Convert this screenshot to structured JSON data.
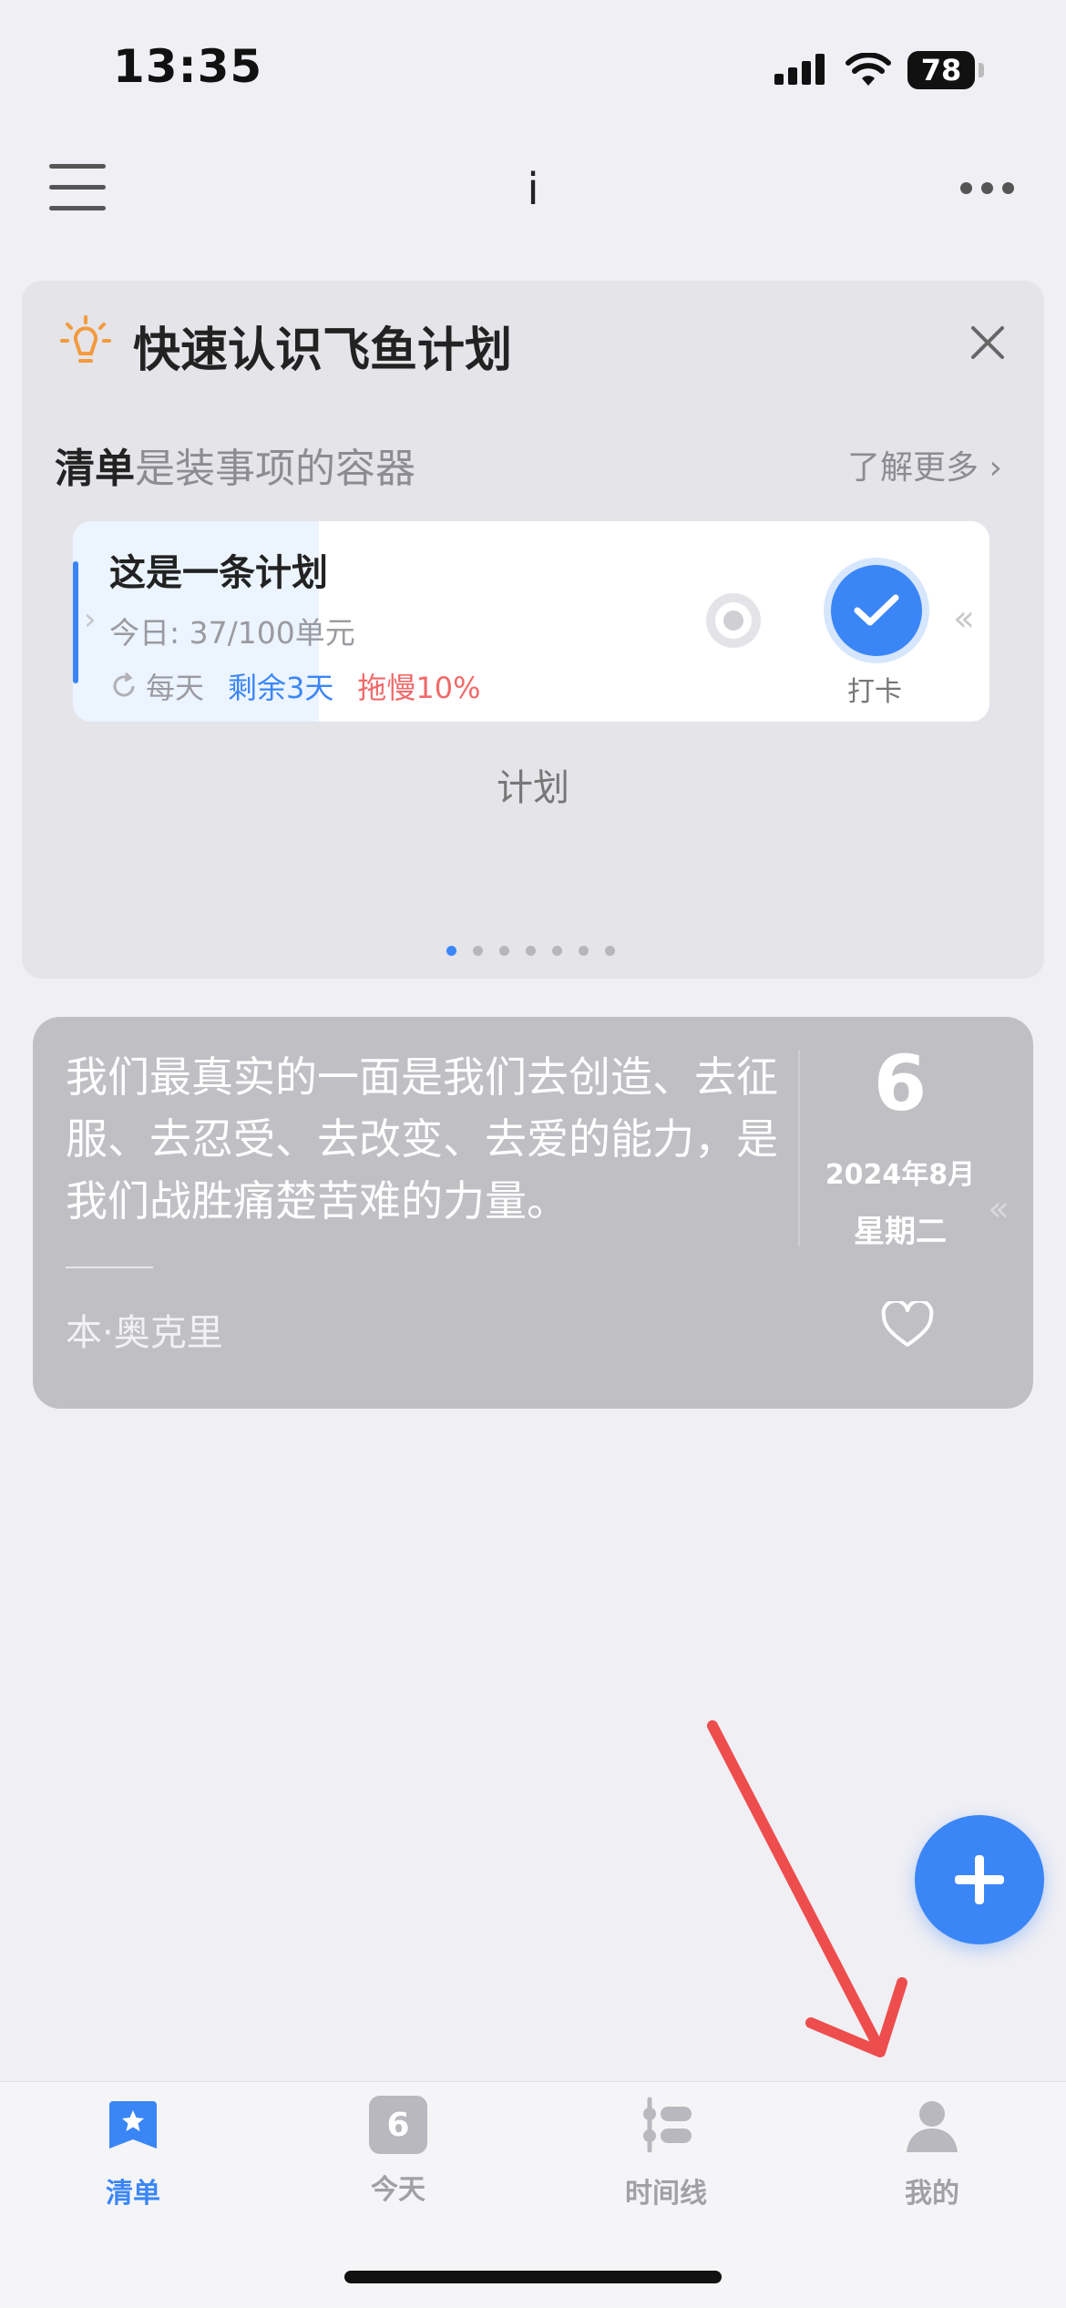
{
  "status_bar": {
    "time": "13:35",
    "battery": "78"
  },
  "nav": {
    "title": "i"
  },
  "intro_card": {
    "title": "快速认识飞鱼计划",
    "subhead_strong": "清单",
    "subhead_rest": "是装事项的容器",
    "learn_more": "了解更多",
    "plan": {
      "name": "这是一条计划",
      "progress": "今日: 37/100单元",
      "frequency": "每天",
      "remaining": "剩余3天",
      "delay": "拖慢10%",
      "check_label": "打卡"
    },
    "caption": "计划",
    "pager": {
      "count": 7,
      "active_index": 0
    }
  },
  "quote_card": {
    "text": "我们最真实的一面是我们去创造、去征服、去忍受、去改变、去爱的能力，是我们战胜痛楚苦难的力量。",
    "author": "本·奥克里",
    "day": "6",
    "year_month": "2024年8月",
    "weekday": "星期二"
  },
  "tabs": [
    {
      "label": "清单",
      "icon": "list-star-icon",
      "active": true
    },
    {
      "label": "今天",
      "icon": "calendar-day-icon",
      "day": "6",
      "active": false
    },
    {
      "label": "时间线",
      "icon": "timeline-icon",
      "active": false
    },
    {
      "label": "我的",
      "icon": "user-icon",
      "active": false
    }
  ],
  "colors": {
    "accent": "#3b86f7",
    "danger": "#f06a6a",
    "background": "#efeff4"
  }
}
